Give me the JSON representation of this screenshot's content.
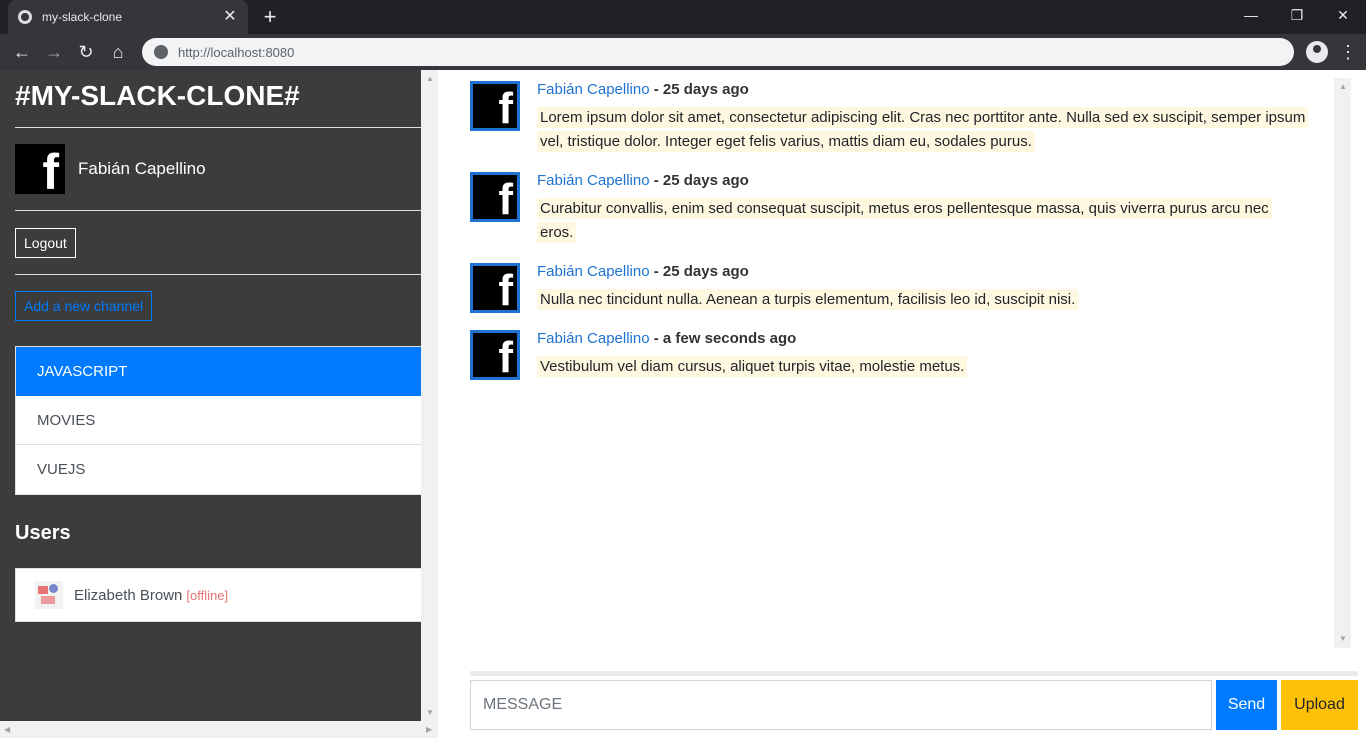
{
  "browser": {
    "tab_title": "my-slack-clone",
    "tab_close": "✕",
    "new_tab": "+",
    "url": "http://localhost:8080",
    "win_minimize": "—",
    "win_restore": "❐",
    "win_close": "✕",
    "back": "←",
    "forward": "→",
    "reload": "↻",
    "home": "⌂",
    "menu": "⋮"
  },
  "sidebar": {
    "brand": "#MY-SLACK-CLONE#",
    "current_user": "Fabián Capellino",
    "avatar_letter": "f",
    "logout_label": "Logout",
    "add_channel_label": "Add a new channel",
    "channels": [
      {
        "label": "JAVASCRIPT",
        "active": true
      },
      {
        "label": "MOVIES",
        "active": false
      },
      {
        "label": "VUEJS",
        "active": false
      }
    ],
    "users_heading": "Users",
    "users": [
      {
        "name": "Elizabeth Brown",
        "status": "[offline]"
      }
    ]
  },
  "messages": [
    {
      "author": "Fabián Capellino",
      "separator": " - ",
      "time": "25 days ago",
      "text": "Lorem ipsum dolor sit amet, consectetur adipiscing elit. Cras nec porttitor ante. Nulla sed ex suscipit, semper ipsum vel, tristique dolor. Integer eget felis varius, mattis diam eu, sodales purus."
    },
    {
      "author": "Fabián Capellino",
      "separator": " - ",
      "time": "25 days ago",
      "text": "Curabitur convallis, enim sed consequat suscipit, metus eros pellentesque massa, quis viverra purus arcu nec eros."
    },
    {
      "author": "Fabián Capellino",
      "separator": " - ",
      "time": "25 days ago",
      "text": "Nulla nec tincidunt nulla. Aenean a turpis elementum, facilisis leo id, suscipit nisi."
    },
    {
      "author": "Fabián Capellino",
      "separator": " - ",
      "time": "a few seconds ago",
      "text": "Vestibulum vel diam cursus, aliquet turpis vitae, molestie metus."
    }
  ],
  "composer": {
    "placeholder": "MESSAGE",
    "value": "",
    "send_label": "Send",
    "upload_label": "Upload"
  },
  "colors": {
    "sidebar_bg": "#3c3c3c",
    "primary": "#007bff",
    "warning": "#ffc107",
    "author_link": "#1e73d2",
    "message_highlight": "#fff8e1"
  }
}
